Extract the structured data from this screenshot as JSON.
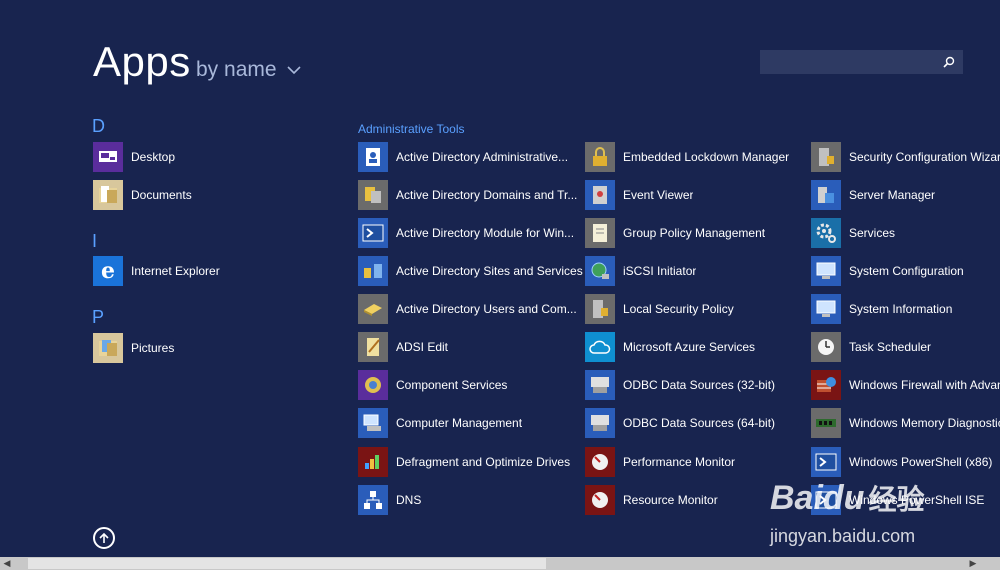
{
  "header": {
    "title": "Apps",
    "sort_label": "by name",
    "search": {
      "placeholder": ""
    }
  },
  "left_groups": [
    {
      "letter": "D",
      "items": [
        {
          "label": "Desktop",
          "icon": "desktop-icon"
        },
        {
          "label": "Documents",
          "icon": "documents-folder-icon"
        }
      ]
    },
    {
      "letter": "I",
      "items": [
        {
          "label": "Internet Explorer",
          "icon": "internet-explorer-icon"
        }
      ]
    },
    {
      "letter": "P",
      "items": [
        {
          "label": "Pictures",
          "icon": "pictures-folder-icon"
        }
      ]
    }
  ],
  "admin_tools": {
    "heading": "Administrative Tools",
    "columns": [
      [
        {
          "label": "Active Directory Administrative...",
          "icon": "ad-admin-center-icon"
        },
        {
          "label": "Active Directory Domains and Tr...",
          "icon": "ad-domains-trusts-icon"
        },
        {
          "label": "Active Directory Module for Win...",
          "icon": "powershell-icon"
        },
        {
          "label": "Active Directory Sites and Services",
          "icon": "ad-sites-icon"
        },
        {
          "label": "Active Directory Users and Com...",
          "icon": "ad-users-icon"
        },
        {
          "label": "ADSI Edit",
          "icon": "adsi-edit-icon"
        },
        {
          "label": "Component Services",
          "icon": "component-services-icon"
        },
        {
          "label": "Computer Management",
          "icon": "computer-management-icon"
        },
        {
          "label": "Defragment and Optimize Drives",
          "icon": "defrag-icon"
        },
        {
          "label": "DNS",
          "icon": "dns-icon"
        }
      ],
      [
        {
          "label": "Embedded Lockdown Manager",
          "icon": "lock-icon"
        },
        {
          "label": "Event Viewer",
          "icon": "event-viewer-icon"
        },
        {
          "label": "Group Policy Management",
          "icon": "group-policy-icon"
        },
        {
          "label": "iSCSI Initiator",
          "icon": "iscsi-globe-icon"
        },
        {
          "label": "Local Security Policy",
          "icon": "security-policy-icon"
        },
        {
          "label": "Microsoft Azure Services",
          "icon": "azure-cloud-icon"
        },
        {
          "label": "ODBC Data Sources (32-bit)",
          "icon": "odbc-icon"
        },
        {
          "label": "ODBC Data Sources (64-bit)",
          "icon": "odbc-icon"
        },
        {
          "label": "Performance Monitor",
          "icon": "performance-monitor-icon"
        },
        {
          "label": "Resource Monitor",
          "icon": "resource-monitor-icon"
        }
      ],
      [
        {
          "label": "Security Configuration Wizard",
          "icon": "security-wizard-icon"
        },
        {
          "label": "Server Manager",
          "icon": "server-manager-icon"
        },
        {
          "label": "Services",
          "icon": "services-gear-icon"
        },
        {
          "label": "System Configuration",
          "icon": "system-configuration-icon"
        },
        {
          "label": "System Information",
          "icon": "system-information-icon"
        },
        {
          "label": "Task Scheduler",
          "icon": "task-scheduler-clock-icon"
        },
        {
          "label": "Windows Firewall with Advance",
          "icon": "firewall-icon"
        },
        {
          "label": "Windows Memory Diagnostic",
          "icon": "memory-chip-icon"
        },
        {
          "label": "Windows PowerShell (x86)",
          "icon": "powershell-icon"
        },
        {
          "label": "Windows PowerShell ISE",
          "icon": "powershell-ise-icon"
        }
      ]
    ]
  },
  "watermark": {
    "brand": "Baidu",
    "cn": "经验",
    "url": "jingyan.baidu.com"
  },
  "colors": {
    "background": "#18244f",
    "accent": "#5aa0ff",
    "tile_blue": "#2a5dba",
    "tile_purple": "#5a2d9c",
    "tile_red": "#7a1414"
  }
}
